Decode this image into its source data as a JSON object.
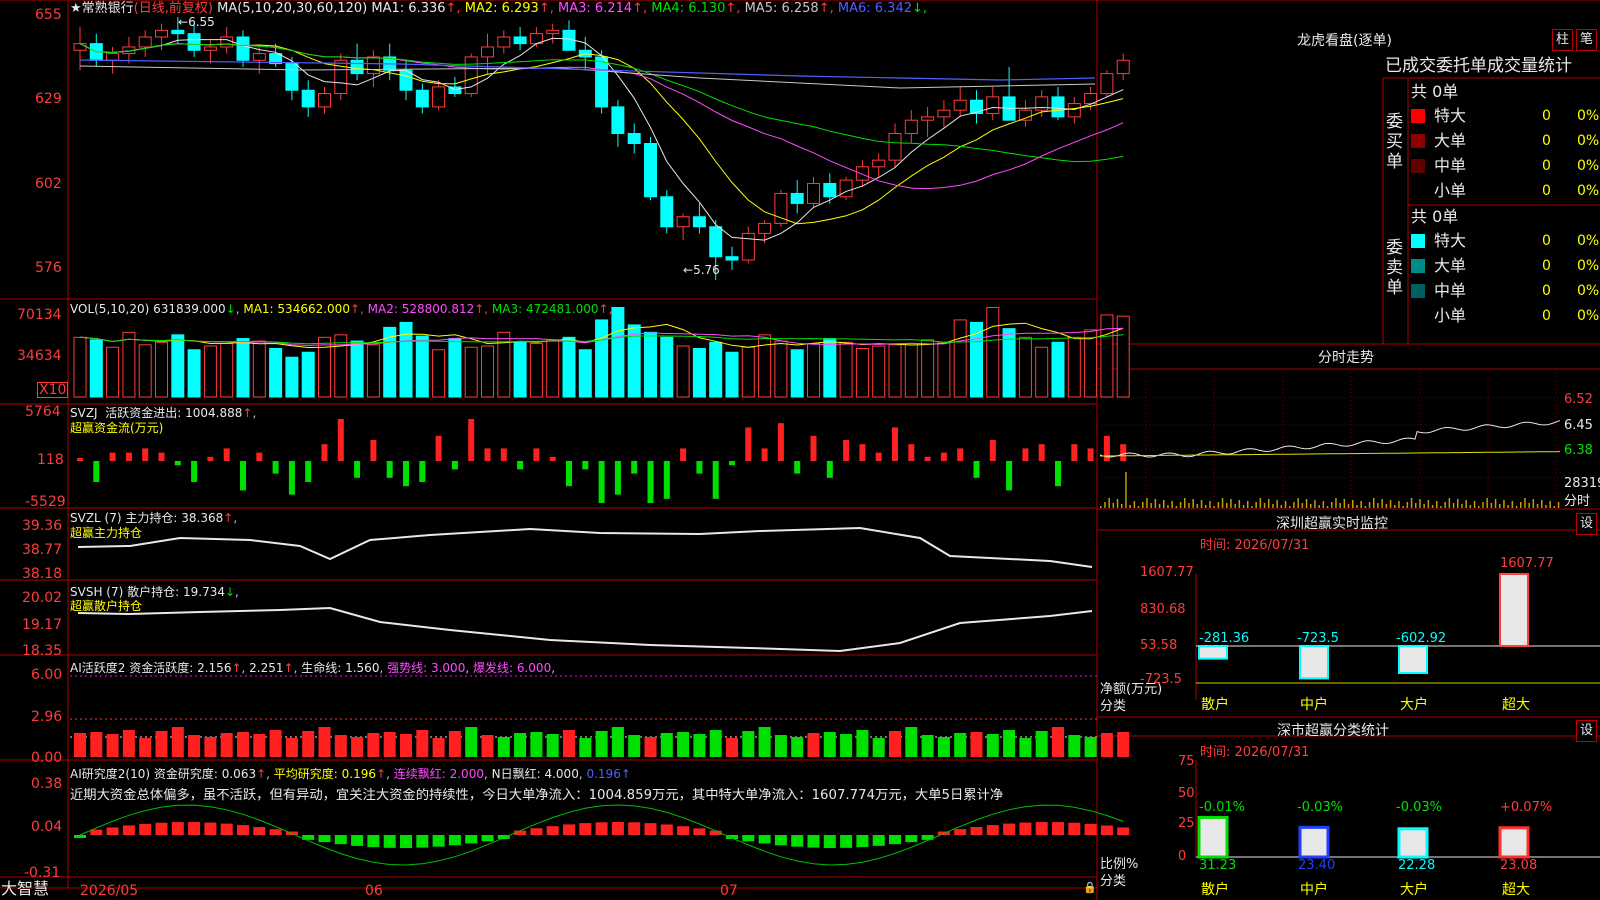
{
  "app_name": "大智慧",
  "stock": {
    "name": "★常熟银行",
    "period": "(日线,前复权)",
    "high_label": "6.55",
    "low_label": "5.76",
    "ma_header": "MA(5,10,20,30,60,120)",
    "ma": [
      {
        "label": "MA1:",
        "value": "6.336",
        "arrow": "↑",
        "color": "#e8e8e8"
      },
      {
        "label": "MA2:",
        "value": "6.293",
        "arrow": "↑",
        "color": "#ffff00"
      },
      {
        "label": "MA3:",
        "value": "6.214",
        "arrow": "↑",
        "color": "#ff4cff"
      },
      {
        "label": "MA4:",
        "value": "6.130",
        "arrow": "↑",
        "color": "#00e000"
      },
      {
        "label": "MA5:",
        "value": "6.258",
        "arrow": "↑",
        "color": "#c8c8c8"
      },
      {
        "label": "MA6:",
        "value": "6.342",
        "arrow": "↓",
        "color": "#5060ff"
      }
    ],
    "price_ticks": [
      "655",
      "629",
      "602",
      "576"
    ]
  },
  "volume": {
    "header": "VOL(5,10,20)",
    "value": "631839.000",
    "ma": [
      {
        "label": "MA1:",
        "value": "534662.000",
        "color": "#ffff00"
      },
      {
        "label": "MA2:",
        "value": "528800.812",
        "color": "#ff4cff"
      },
      {
        "label": "MA3:",
        "value": "472481.000",
        "color": "#00e000"
      }
    ],
    "ticks": [
      "70134",
      "34634"
    ],
    "unit": "X10"
  },
  "svzj": {
    "header": "SVZJ",
    "label": "活跃资金进出:",
    "value": "1004.888",
    "sub": "超赢资金流(万元)",
    "ticks": [
      "5764",
      "118",
      "-5529"
    ]
  },
  "svzl": {
    "header": "SVZL (7)",
    "label": "主力持仓:",
    "value": "38.368",
    "sub": "超赢主力持仓",
    "ticks": [
      "39.36",
      "38.77",
      "38.18"
    ]
  },
  "svsh": {
    "header": "SVSH (7)",
    "label": "散户持仓:",
    "value": "19.734",
    "sub": "超赢散户持仓",
    "ticks": [
      "20.02",
      "19.17",
      "18.35"
    ]
  },
  "ai_active": {
    "header": "AI活跃度2",
    "label": "资金活跃度:",
    "value": "2.156",
    "v2": "2.251",
    "life_label": "生命线:",
    "life": "1.560",
    "strong_label": "强势线:",
    "strong": "3.000",
    "burst_label": "爆发线:",
    "burst": "6.000",
    "ticks": [
      "6.00",
      "2.96",
      "0.00"
    ]
  },
  "ai_research": {
    "header": "AI研究度2(10)",
    "label": "资金研究度:",
    "value": "0.063",
    "avg_label": "平均研究度:",
    "avg": "0.196",
    "cont_label": "连续飘红:",
    "cont": "2.000",
    "n_label": "N日飘红:",
    "n": "4.000",
    "last": "0.196",
    "note": "近期大资金总体偏多，虽不活跃，但有异动，宜关注大资金的持续性，今日大单净流入：1004.859万元，其中特大单净流入：1607.774万元，大单5日累计净",
    "ticks": [
      "0.38",
      "0.04",
      "-0.31"
    ]
  },
  "dates": [
    "2026/05",
    "06",
    "07"
  ],
  "panel": {
    "title": "龙虎看盘(逐单)",
    "btn_zhu": "柱",
    "btn_bi": "笔",
    "tab_title": "已成交委托单成交量统计",
    "buy_label": "委买单",
    "sell_label": "委卖单",
    "buy_total": "共 0单",
    "sell_total": "共 0单",
    "buy_rows": [
      {
        "name": "特大",
        "qty": "0",
        "pct": "0%",
        "color": "#ff0000"
      },
      {
        "name": "大单",
        "qty": "0",
        "pct": "0%",
        "color": "#8b0000"
      },
      {
        "name": "中单",
        "qty": "0",
        "pct": "0%",
        "color": "#600000"
      },
      {
        "name": "小单",
        "qty": "0",
        "pct": "0%",
        "color": "#000000"
      }
    ],
    "sell_rows": [
      {
        "name": "特大",
        "qty": "0",
        "pct": "0%",
        "color": "#00ffff"
      },
      {
        "name": "大单",
        "qty": "0",
        "pct": "0%",
        "color": "#008b8b"
      },
      {
        "name": "中单",
        "qty": "0",
        "pct": "0%",
        "color": "#006060"
      },
      {
        "name": "小单",
        "qty": "0",
        "pct": "0%",
        "color": "#000000"
      }
    ]
  },
  "intraday": {
    "title": "分时走势",
    "ticks": [
      "6.52",
      "6.45",
      "6.38"
    ],
    "vol_label": "28319",
    "unit_label": "分时"
  },
  "monitor": {
    "title": "深圳超赢实时监控",
    "set_label": "设",
    "time": "时间: 2026/07/31",
    "ticks": [
      "1607.77",
      "830.68",
      "53.58",
      "-723.5"
    ],
    "ylabel": "净额(万元)",
    "xlabel": "分类",
    "categories": [
      "散户",
      "中户",
      "大户",
      "超大"
    ],
    "value_labels": [
      "-281.36",
      "-723.5",
      "-602.92",
      "1607.77"
    ]
  },
  "classify": {
    "title": "深市超赢分类统计",
    "set_label": "设",
    "time": "时间: 2026/07/31",
    "ticks": [
      "75",
      "50",
      "25",
      "0"
    ],
    "ylabel": "比例%",
    "xlabel": "分类",
    "categories": [
      "散户",
      "中户",
      "大户",
      "超大"
    ],
    "change_labels": [
      "-0.01%",
      "-0.03%",
      "-0.03%",
      "+0.07%"
    ],
    "value_labels": [
      "31.23",
      "23.40",
      "22.28",
      "23.08"
    ]
  },
  "chart_data": [
    {
      "type": "candlestick",
      "title": "常熟银行 日线 前复权",
      "y_range": [
        5.73,
        6.58
      ],
      "candles": [
        [
          6.45,
          6.52,
          6.39,
          6.47
        ],
        [
          6.47,
          6.5,
          6.4,
          6.42
        ],
        [
          6.42,
          6.46,
          6.38,
          6.44
        ],
        [
          6.44,
          6.49,
          6.41,
          6.46
        ],
        [
          6.46,
          6.51,
          6.43,
          6.49
        ],
        [
          6.49,
          6.53,
          6.45,
          6.51
        ],
        [
          6.51,
          6.55,
          6.47,
          6.5
        ],
        [
          6.5,
          6.53,
          6.43,
          6.45
        ],
        [
          6.45,
          6.48,
          6.41,
          6.46
        ],
        [
          6.46,
          6.52,
          6.44,
          6.49
        ],
        [
          6.49,
          6.51,
          6.4,
          6.42
        ],
        [
          6.42,
          6.46,
          6.38,
          6.44
        ],
        [
          6.44,
          6.47,
          6.4,
          6.41
        ],
        [
          6.41,
          6.43,
          6.3,
          6.33
        ],
        [
          6.33,
          6.36,
          6.25,
          6.28
        ],
        [
          6.28,
          6.34,
          6.26,
          6.32
        ],
        [
          6.32,
          6.44,
          6.3,
          6.42
        ],
        [
          6.42,
          6.47,
          6.36,
          6.38
        ],
        [
          6.38,
          6.45,
          6.34,
          6.43
        ],
        [
          6.43,
          6.47,
          6.36,
          6.39
        ],
        [
          6.39,
          6.42,
          6.3,
          6.33
        ],
        [
          6.33,
          6.35,
          6.26,
          6.28
        ],
        [
          6.28,
          6.36,
          6.27,
          6.34
        ],
        [
          6.34,
          6.37,
          6.31,
          6.32
        ],
        [
          6.32,
          6.44,
          6.31,
          6.43
        ],
        [
          6.43,
          6.5,
          6.38,
          6.46
        ],
        [
          6.46,
          6.51,
          6.44,
          6.49
        ],
        [
          6.49,
          6.52,
          6.45,
          6.47
        ],
        [
          6.47,
          6.52,
          6.46,
          6.5
        ],
        [
          6.5,
          6.53,
          6.47,
          6.51
        ],
        [
          6.51,
          6.54,
          6.48,
          6.45
        ],
        [
          6.45,
          6.49,
          6.39,
          6.43
        ],
        [
          6.43,
          6.45,
          6.26,
          6.28
        ],
        [
          6.28,
          6.3,
          6.16,
          6.2
        ],
        [
          6.2,
          6.23,
          6.14,
          6.17
        ],
        [
          6.17,
          6.19,
          6.0,
          6.01
        ],
        [
          6.01,
          6.03,
          5.9,
          5.92
        ],
        [
          5.92,
          5.96,
          5.88,
          5.95
        ],
        [
          5.95,
          5.99,
          5.9,
          5.92
        ],
        [
          5.92,
          5.94,
          5.76,
          5.83
        ],
        [
          5.83,
          5.86,
          5.79,
          5.82
        ],
        [
          5.82,
          5.92,
          5.81,
          5.9
        ],
        [
          5.9,
          5.94,
          5.87,
          5.93
        ],
        [
          5.93,
          6.03,
          5.92,
          6.02
        ],
        [
          6.02,
          6.06,
          5.96,
          5.99
        ],
        [
          5.99,
          6.07,
          5.98,
          6.05
        ],
        [
          6.05,
          6.08,
          5.99,
          6.01
        ],
        [
          6.01,
          6.07,
          6.0,
          6.06
        ],
        [
          6.06,
          6.12,
          6.04,
          6.1
        ],
        [
          6.1,
          6.14,
          6.07,
          6.12
        ],
        [
          6.12,
          6.23,
          6.1,
          6.2
        ],
        [
          6.2,
          6.27,
          6.17,
          6.24
        ],
        [
          6.24,
          6.28,
          6.19,
          6.25
        ],
        [
          6.25,
          6.3,
          6.22,
          6.27
        ],
        [
          6.27,
          6.34,
          6.25,
          6.3
        ],
        [
          6.3,
          6.33,
          6.23,
          6.26
        ],
        [
          6.26,
          6.34,
          6.24,
          6.31
        ],
        [
          6.31,
          6.4,
          6.28,
          6.24
        ],
        [
          6.24,
          6.3,
          6.22,
          6.27
        ],
        [
          6.27,
          6.33,
          6.25,
          6.31
        ],
        [
          6.31,
          6.34,
          6.24,
          6.25
        ],
        [
          6.25,
          6.31,
          6.23,
          6.29
        ],
        [
          6.29,
          6.34,
          6.27,
          6.32
        ],
        [
          6.32,
          6.39,
          6.31,
          6.38
        ],
        [
          6.38,
          6.44,
          6.36,
          6.42
        ]
      ]
    },
    {
      "type": "bar",
      "title": "VOL(5,10,20)",
      "y_range": [
        0,
        74000
      ],
      "values": [
        48000,
        46000,
        40000,
        52000,
        42000,
        44000,
        50000,
        38000,
        41000,
        43000,
        47000,
        45000,
        39000,
        32000,
        36000,
        48000,
        50000,
        45000,
        42000,
        56000,
        60000,
        49000,
        38000,
        47000,
        40000,
        41000,
        52000,
        44000,
        43000,
        46000,
        48000,
        38000,
        62000,
        72000,
        58000,
        52000,
        48000,
        41000,
        39000,
        44000,
        36000,
        40000,
        50000,
        45000,
        38000,
        43000,
        47000,
        44000,
        39000,
        41000,
        42000,
        43000,
        46000,
        44000,
        62000,
        60000,
        72000,
        55000,
        48000,
        40000,
        44000,
        48000,
        54000,
        66000,
        65000
      ]
    }
  ]
}
